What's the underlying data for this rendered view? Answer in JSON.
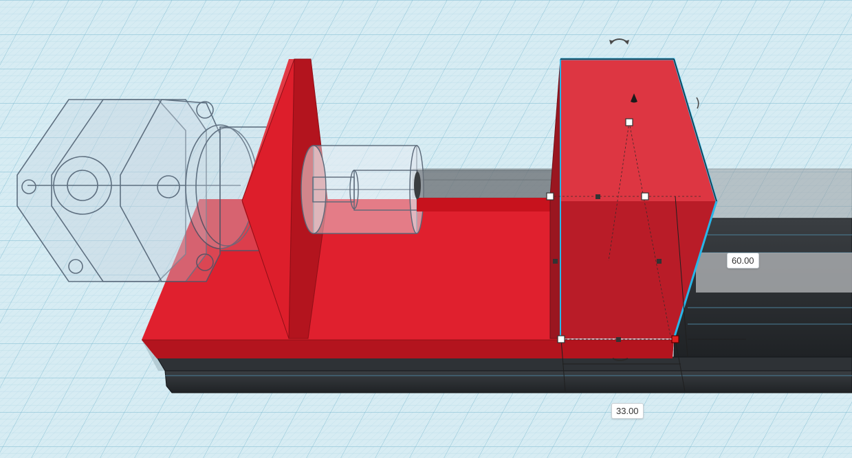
{
  "workplane": {
    "grid_color": "#9ccbdc",
    "background_color": "#d7ecf3"
  },
  "colors": {
    "shape_red": "#e0202e",
    "shape_red_dark": "#b8141f",
    "selection_outline": "#29b6e8",
    "rail_black": "#2a2d30",
    "handle_active": "#e02020"
  },
  "dimensions": {
    "height_value": "60.00",
    "width_value": "33.00"
  },
  "icons": {
    "rotate": "rotate-arrow-icon",
    "lift": "cone-lift-icon"
  }
}
